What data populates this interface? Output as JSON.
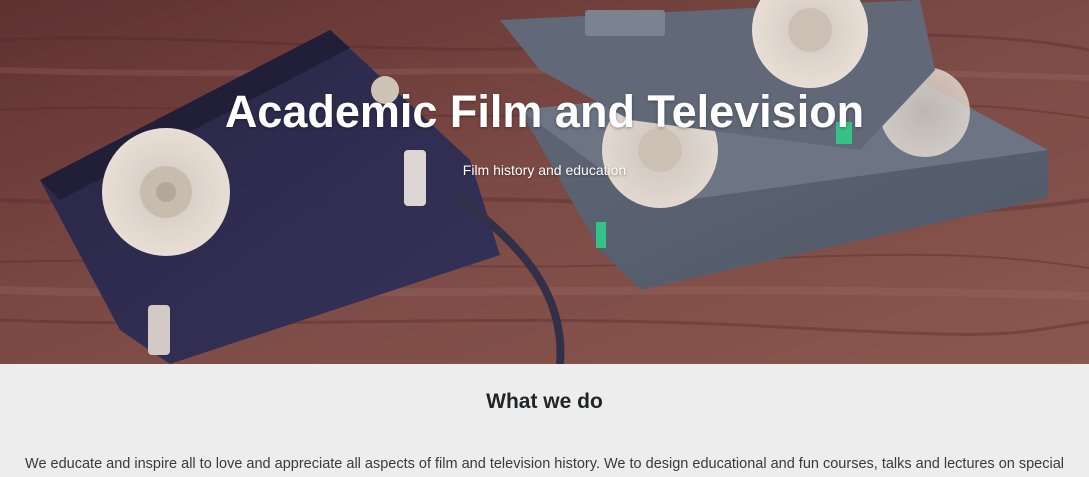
{
  "hero": {
    "title": "Academic Film and Television",
    "subtitle": "Film history and education",
    "image": "vhs-cassettes-on-wooden-table"
  },
  "about": {
    "heading": "What we do",
    "text": "We educate and inspire all to love and appreciate all aspects of film and television history. We to design educational and fun courses, talks and lectures on special"
  },
  "colors": {
    "section_background": "#ededed",
    "heading_text": "#222426",
    "body_text": "#3a3a3a",
    "hero_text": "#ffffff"
  }
}
